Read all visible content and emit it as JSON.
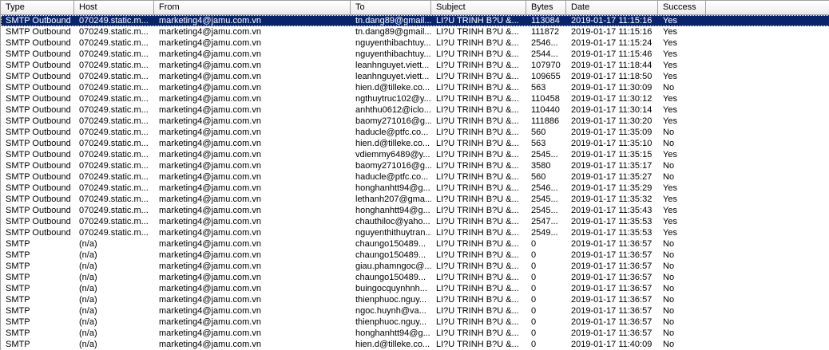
{
  "columns": {
    "type": "Type",
    "host": "Host",
    "from": "From",
    "to": "To",
    "subject": "Subject",
    "bytes": "Bytes",
    "date": "Date",
    "success": "Success"
  },
  "rows": [
    {
      "type": "SMTP Outbound",
      "host": "070249.static.m...",
      "from": "marketing4@jamu.com.vn",
      "to": "tn.dang89@gmail....",
      "subject": "LI?U TRINH B?U &...",
      "bytes": "113084",
      "date": "2019-01-17 11:15:16",
      "success": "Yes",
      "selected": true
    },
    {
      "type": "SMTP Outbound",
      "host": "070249.static.m...",
      "from": "marketing4@jamu.com.vn",
      "to": "tn.dang89@gmail....",
      "subject": "LI?U TRINH B?U &...",
      "bytes": "111872",
      "date": "2019-01-17 11:15:16",
      "success": "Yes"
    },
    {
      "type": "SMTP Outbound",
      "host": "070249.static.m...",
      "from": "marketing4@jamu.com.vn",
      "to": "nguyenthibachtuy...",
      "subject": "LI?U TRINH B?U &...",
      "bytes": "2546...",
      "date": "2019-01-17 11:15:24",
      "success": "Yes"
    },
    {
      "type": "SMTP Outbound",
      "host": "070249.static.m...",
      "from": "marketing4@jamu.com.vn",
      "to": "nguyenthibachtuy...",
      "subject": "LI?U TRINH B?U &...",
      "bytes": "2544...",
      "date": "2019-01-17 11:15:46",
      "success": "Yes"
    },
    {
      "type": "SMTP Outbound",
      "host": "070249.static.m...",
      "from": "marketing4@jamu.com.vn",
      "to": "leanhnguyet.viett...",
      "subject": "LI?U TRINH B?U &...",
      "bytes": "107970",
      "date": "2019-01-17 11:18:44",
      "success": "Yes"
    },
    {
      "type": "SMTP Outbound",
      "host": "070249.static.m...",
      "from": "marketing4@jamu.com.vn",
      "to": "leanhnguyet.viett...",
      "subject": "LI?U TRINH B?U &...",
      "bytes": "109655",
      "date": "2019-01-17 11:18:50",
      "success": "Yes"
    },
    {
      "type": "SMTP Outbound",
      "host": "070249.static.m...",
      "from": "marketing4@jamu.com.vn",
      "to": "hien.d@tilleke.co...",
      "subject": "LI?U TRINH B?U &...",
      "bytes": "563",
      "date": "2019-01-17 11:30:09",
      "success": "No"
    },
    {
      "type": "SMTP Outbound",
      "host": "070249.static.m...",
      "from": "marketing4@jamu.com.vn",
      "to": "ngthuytruc102@y...",
      "subject": "LI?U TRINH B?U &...",
      "bytes": "110458",
      "date": "2019-01-17 11:30:12",
      "success": "Yes"
    },
    {
      "type": "SMTP Outbound",
      "host": "070249.static.m...",
      "from": "marketing4@jamu.com.vn",
      "to": "anhthu0612@iclo...",
      "subject": "LI?U TRINH B?U &...",
      "bytes": "110440",
      "date": "2019-01-17 11:30:14",
      "success": "Yes"
    },
    {
      "type": "SMTP Outbound",
      "host": "070249.static.m...",
      "from": "marketing4@jamu.com.vn",
      "to": "baomy271016@g...",
      "subject": "LI?U TRINH B?U &...",
      "bytes": "111886",
      "date": "2019-01-17 11:30:20",
      "success": "Yes"
    },
    {
      "type": "SMTP Outbound",
      "host": "070249.static.m...",
      "from": "marketing4@jamu.com.vn",
      "to": "haducle@ptfc.co...",
      "subject": "LI?U TRINH B?U &...",
      "bytes": "560",
      "date": "2019-01-17 11:35:09",
      "success": "No"
    },
    {
      "type": "SMTP Outbound",
      "host": "070249.static.m...",
      "from": "marketing4@jamu.com.vn",
      "to": "hien.d@tilleke.co...",
      "subject": "LI?U TRINH B?U &...",
      "bytes": "563",
      "date": "2019-01-17 11:35:10",
      "success": "No"
    },
    {
      "type": "SMTP Outbound",
      "host": "070249.static.m...",
      "from": "marketing4@jamu.com.vn",
      "to": "vdiemmy6489@y...",
      "subject": "LI?U TRINH B?U &...",
      "bytes": "2545...",
      "date": "2019-01-17 11:35:15",
      "success": "Yes"
    },
    {
      "type": "SMTP Outbound",
      "host": "070249.static.m...",
      "from": "marketing4@jamu.com.vn",
      "to": "baomy271016@g...",
      "subject": "LI?U TRINH B?U &...",
      "bytes": "3580",
      "date": "2019-01-17 11:35:17",
      "success": "No"
    },
    {
      "type": "SMTP Outbound",
      "host": "070249.static.m...",
      "from": "marketing4@jamu.com.vn",
      "to": "haducle@ptfc.co...",
      "subject": "LI?U TRINH B?U &...",
      "bytes": "560",
      "date": "2019-01-17 11:35:27",
      "success": "No"
    },
    {
      "type": "SMTP Outbound",
      "host": "070249.static.m...",
      "from": "marketing4@jamu.com.vn",
      "to": "honghanhtt94@g...",
      "subject": "LI?U TRINH B?U &...",
      "bytes": "2546...",
      "date": "2019-01-17 11:35:29",
      "success": "Yes"
    },
    {
      "type": "SMTP Outbound",
      "host": "070249.static.m...",
      "from": "marketing4@jamu.com.vn",
      "to": "lethanh207@gma...",
      "subject": "LI?U TRINH B?U &...",
      "bytes": "2545...",
      "date": "2019-01-17 11:35:32",
      "success": "Yes"
    },
    {
      "type": "SMTP Outbound",
      "host": "070249.static.m...",
      "from": "marketing4@jamu.com.vn",
      "to": "honghanhtt94@g...",
      "subject": "LI?U TRINH B?U &...",
      "bytes": "2545...",
      "date": "2019-01-17 11:35:43",
      "success": "Yes"
    },
    {
      "type": "SMTP Outbound",
      "host": "070249.static.m...",
      "from": "marketing4@jamu.com.vn",
      "to": "chauthiloc@yaho...",
      "subject": "LI?U TRINH B?U &...",
      "bytes": "2547...",
      "date": "2019-01-17 11:35:53",
      "success": "Yes"
    },
    {
      "type": "SMTP Outbound",
      "host": "070249.static.m...",
      "from": "marketing4@jamu.com.vn",
      "to": "nguyenthithuytran...",
      "subject": "LI?U TRINH B?U &...",
      "bytes": "2549...",
      "date": "2019-01-17 11:35:53",
      "success": "Yes"
    },
    {
      "type": "SMTP",
      "host": "(n/a)",
      "from": "marketing4@jamu.com.vn",
      "to": "chaungo150489...",
      "subject": "LI?U TRINH B?U &...",
      "bytes": "0",
      "date": "2019-01-17 11:36:57",
      "success": "No"
    },
    {
      "type": "SMTP",
      "host": "(n/a)",
      "from": "marketing4@jamu.com.vn",
      "to": "chaungo150489...",
      "subject": "LI?U TRINH B?U &...",
      "bytes": "0",
      "date": "2019-01-17 11:36:57",
      "success": "No"
    },
    {
      "type": "SMTP",
      "host": "(n/a)",
      "from": "marketing4@jamu.com.vn",
      "to": "giau.phamngoc@...",
      "subject": "LI?U TRINH B?U &...",
      "bytes": "0",
      "date": "2019-01-17 11:36:57",
      "success": "No"
    },
    {
      "type": "SMTP",
      "host": "(n/a)",
      "from": "marketing4@jamu.com.vn",
      "to": "chaungo150489...",
      "subject": "LI?U TRINH B?U &...",
      "bytes": "0",
      "date": "2019-01-17 11:36:57",
      "success": "No"
    },
    {
      "type": "SMTP",
      "host": "(n/a)",
      "from": "marketing4@jamu.com.vn",
      "to": "buingocquynhnh...",
      "subject": "LI?U TRINH B?U &...",
      "bytes": "0",
      "date": "2019-01-17 11:36:57",
      "success": "No"
    },
    {
      "type": "SMTP",
      "host": "(n/a)",
      "from": "marketing4@jamu.com.vn",
      "to": "thienphuoc.nguy...",
      "subject": "LI?U TRINH B?U &...",
      "bytes": "0",
      "date": "2019-01-17 11:36:57",
      "success": "No"
    },
    {
      "type": "SMTP",
      "host": "(n/a)",
      "from": "marketing4@jamu.com.vn",
      "to": "ngoc.huynh@va...",
      "subject": "LI?U TRINH B?U &...",
      "bytes": "0",
      "date": "2019-01-17 11:36:57",
      "success": "No"
    },
    {
      "type": "SMTP",
      "host": "(n/a)",
      "from": "marketing4@jamu.com.vn",
      "to": "thienphuoc.nguy...",
      "subject": "LI?U TRINH B?U &...",
      "bytes": "0",
      "date": "2019-01-17 11:36:57",
      "success": "No"
    },
    {
      "type": "SMTP",
      "host": "(n/a)",
      "from": "marketing4@jamu.com.vn",
      "to": "honghanhtt94@g...",
      "subject": "LI?U TRINH B?U &...",
      "bytes": "0",
      "date": "2019-01-17 11:36:57",
      "success": "No"
    },
    {
      "type": "SMTP",
      "host": "(n/a)",
      "from": "marketing4@jamu.com.vn",
      "to": "hien.d@tilleke.co...",
      "subject": "LI?U TRINH B?U &...",
      "bytes": "0",
      "date": "2019-01-17 11:40:09",
      "success": "No"
    }
  ]
}
